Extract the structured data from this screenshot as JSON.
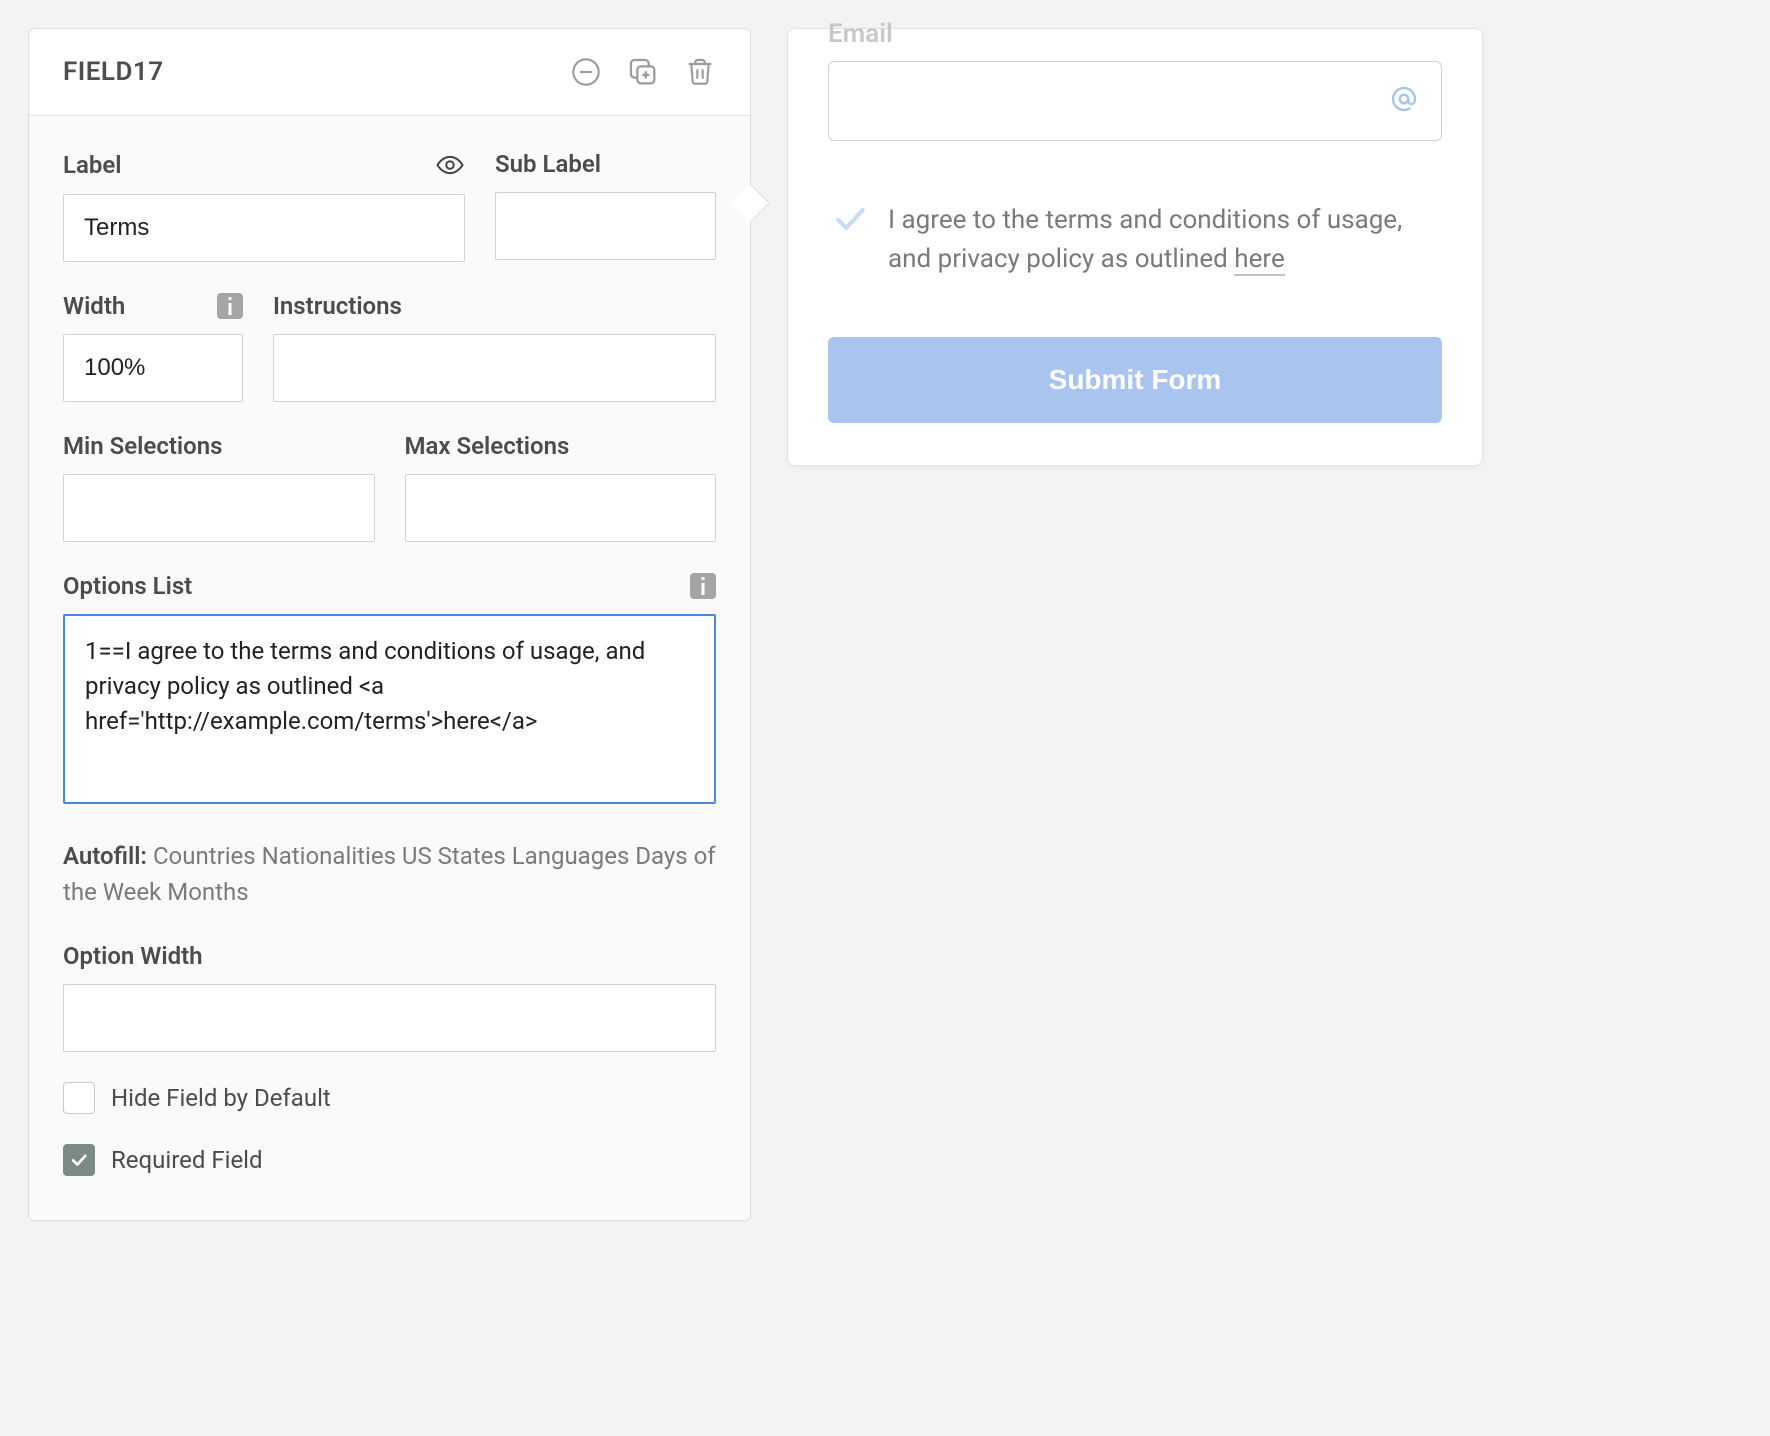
{
  "panel": {
    "title": "FIELD17",
    "label": {
      "text": "Label",
      "value": "Terms"
    },
    "subLabel": {
      "text": "Sub Label",
      "value": ""
    },
    "width": {
      "text": "Width",
      "value": "100%"
    },
    "instructions": {
      "text": "Instructions",
      "value": ""
    },
    "minSelections": {
      "text": "Min Selections",
      "value": ""
    },
    "maxSelections": {
      "text": "Max Selections",
      "value": ""
    },
    "optionsList": {
      "text": "Options List",
      "value": "1==I agree to the terms and conditions of usage, and privacy policy as outlined <a href='http://example.com/terms'>here</a>"
    },
    "autofill": {
      "prefix": "Autofill:",
      "items": "Countries Nationalities US States Languages Days of the Week Months"
    },
    "optionWidth": {
      "text": "Option Width",
      "value": ""
    },
    "hideField": {
      "text": "Hide Field by Default",
      "checked": false
    },
    "required": {
      "text": "Required Field",
      "checked": true
    }
  },
  "preview": {
    "emailLabel": "Email",
    "emailValue": "",
    "termsTextA": "I agree to the terms and conditions of usage, and privacy policy as outlined ",
    "termsLink": "here",
    "submitLabel": "Submit Form"
  }
}
